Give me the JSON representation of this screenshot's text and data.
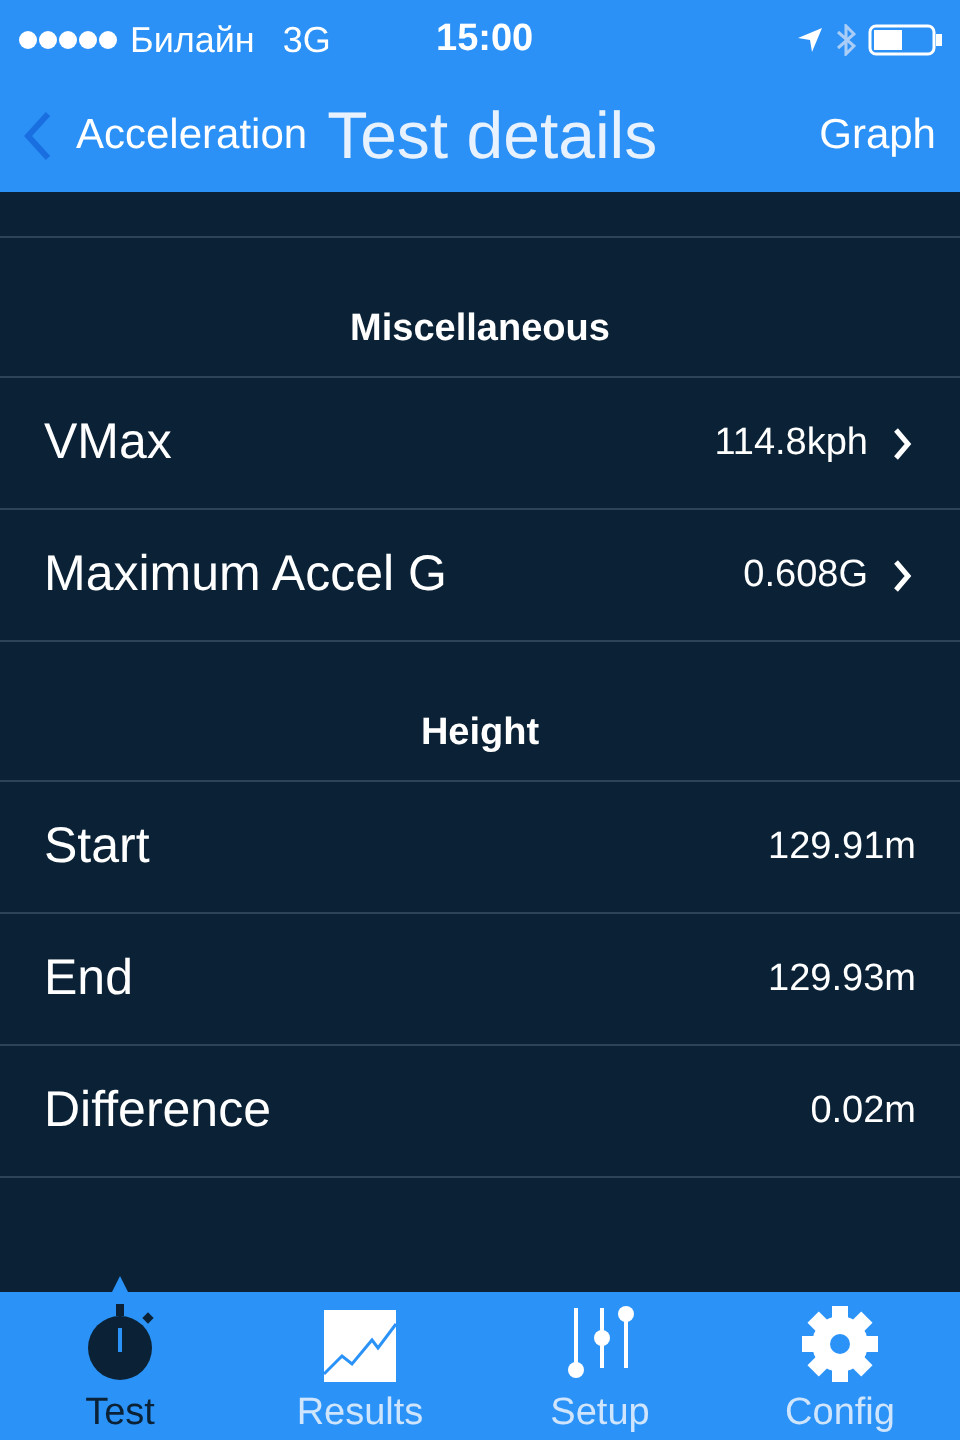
{
  "status_bar": {
    "carrier": "Билайн",
    "network": "3G",
    "time": "15:00"
  },
  "nav": {
    "back": "Acceleration",
    "title": "Test details",
    "action": "Graph"
  },
  "sections": [
    {
      "title": "Miscellaneous",
      "rows": [
        {
          "label": "VMax",
          "value": "114.8kph",
          "kind": "link"
        },
        {
          "label": "Maximum Accel G",
          "value": "0.608G",
          "kind": "link"
        }
      ]
    },
    {
      "title": "Height",
      "rows": [
        {
          "label": "Start",
          "value": "129.91m",
          "kind": "plain"
        },
        {
          "label": "End",
          "value": "129.93m",
          "kind": "plain"
        },
        {
          "label": "Difference",
          "value": "0.02m",
          "kind": "plain"
        }
      ]
    }
  ],
  "tabs": [
    {
      "label": "Test",
      "kind": "stopwatch",
      "selected": true
    },
    {
      "label": "Results",
      "kind": "chart",
      "selected": false
    },
    {
      "label": "Setup",
      "kind": "sliders",
      "selected": false
    },
    {
      "label": "Config",
      "kind": "gear",
      "selected": false
    }
  ]
}
